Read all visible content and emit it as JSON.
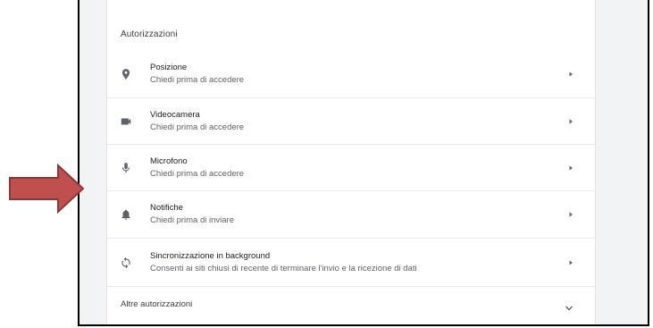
{
  "permissions": {
    "section_title": "Autorizzazioni",
    "items": [
      {
        "icon": "location-pin-icon",
        "title": "Posizione",
        "subtitle": "Chiedi prima di accedere"
      },
      {
        "icon": "videocam-icon",
        "title": "Videocamera",
        "subtitle": "Chiedi prima di accedere"
      },
      {
        "icon": "microphone-icon",
        "title": "Microfono",
        "subtitle": "Chiedi prima di accedere"
      },
      {
        "icon": "bell-icon",
        "title": "Notifiche",
        "subtitle": "Chiedi prima di inviare"
      },
      {
        "icon": "sync-icon",
        "title": "Sincronizzazione in background",
        "subtitle": "Consenti ai siti chiusi di recente di terminare l'invio e la ricezione di dati"
      }
    ],
    "more_label": "Altre autorizzazioni"
  },
  "colors": {
    "icon": "#5f6368",
    "callout_arrow_fill": "#c0504d",
    "callout_arrow_stroke": "#8c3836"
  }
}
